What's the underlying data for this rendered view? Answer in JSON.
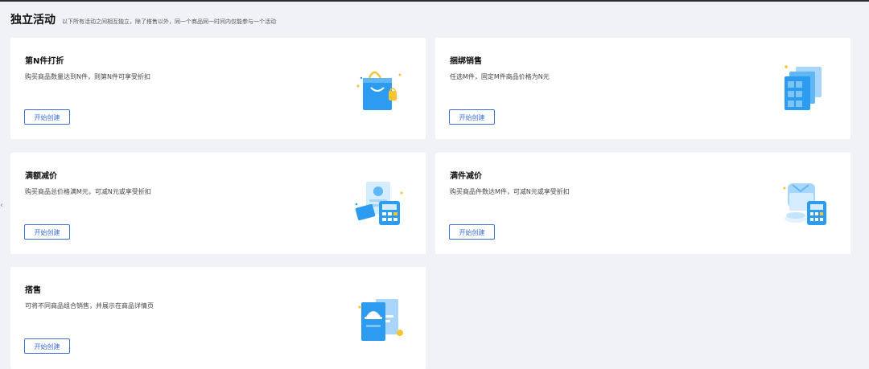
{
  "header": {
    "title": "独立活动",
    "desc": "以下所有活动之间相互独立，除了搭售以外，同一个商品同一时间内仅能参与一个活动"
  },
  "collapse_icon": "chevron-left-icon",
  "cards": [
    {
      "title": "第N件打折",
      "desc": "购买商品数量达到N件，则第N件可享受折扣",
      "button": "开始创建",
      "icon": "shopping-bag-icon"
    },
    {
      "title": "捆绑销售",
      "desc": "任选M件，固定M件商品价格为N元",
      "button": "开始创建",
      "icon": "stacked-products-icon"
    },
    {
      "title": "满额减价",
      "desc": "购买商品总价格满M元，可减N元或享受折扣",
      "button": "开始创建",
      "icon": "calculator-receipt-icon"
    },
    {
      "title": "满件减价",
      "desc": "购买商品件数达M件，可减N元或享受折扣",
      "button": "开始创建",
      "icon": "calculator-clothes-icon"
    },
    {
      "title": "搭售",
      "desc": "可将不同商品组合销售，并展示在商品详情页",
      "button": "开始创建",
      "icon": "hat-cards-icon"
    }
  ],
  "colors": {
    "accent": "#3b6fd8",
    "illustration_blue": "#2d9cf0",
    "illustration_yellow": "#f7c531"
  }
}
